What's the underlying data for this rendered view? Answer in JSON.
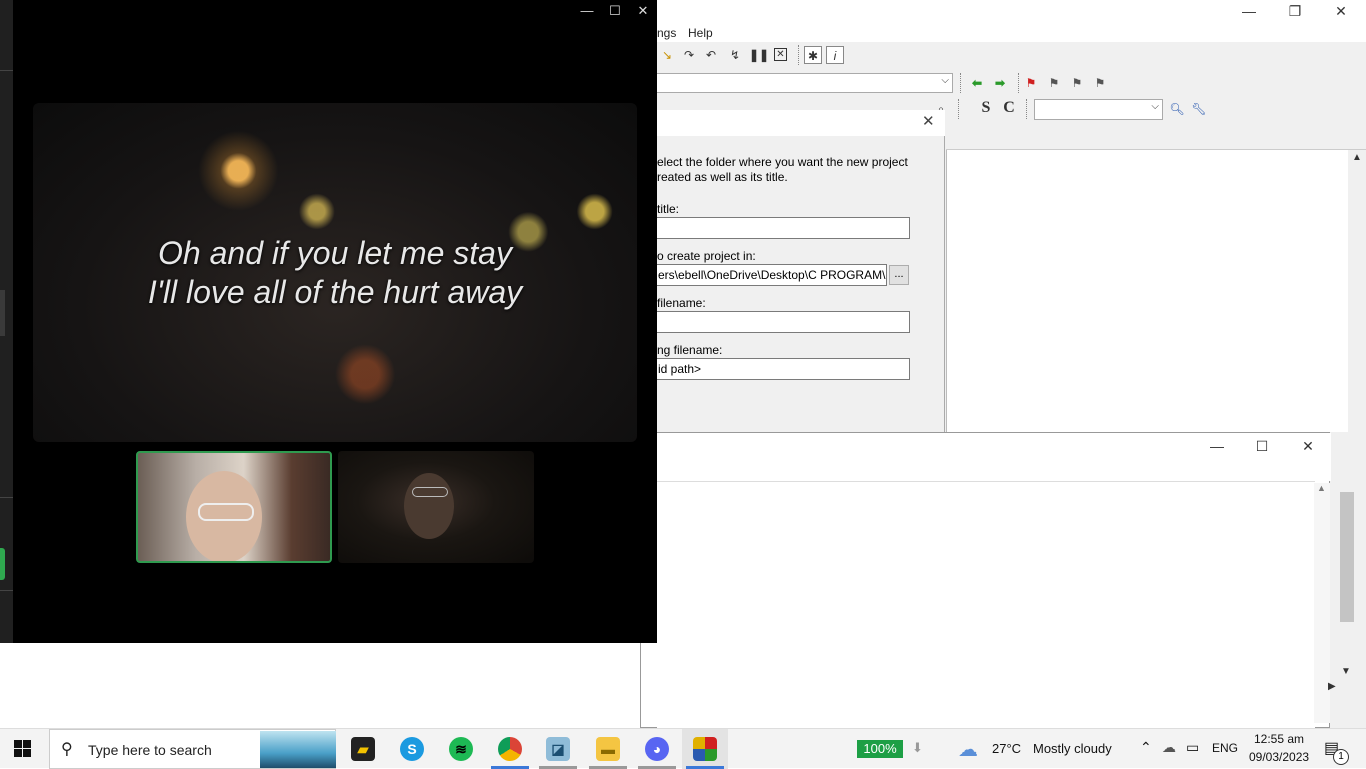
{
  "ide": {
    "menu": {
      "settings_partial": "ngs",
      "help": "Help"
    },
    "window_controls": {
      "minimize": "—",
      "restore": "❐",
      "close": "✕"
    }
  },
  "dialog": {
    "close_icon": "✕",
    "instructions_line1": "elect the folder where you want the new project",
    "instructions_line2": "reated as well as its title.",
    "title_label": "title:",
    "title_value": "",
    "folder_label": "o create project in:",
    "folder_value": "ers\\ebell\\OneDrive\\Desktop\\C PROGRAM\\",
    "browse_label": "...",
    "filename_label": "filename:",
    "filename_value": "",
    "existing_label": "ng filename:",
    "existing_value": "id path>"
  },
  "console": {
    "window_controls": {
      "minimize": "—",
      "maximize": "☐",
      "close": "✕"
    }
  },
  "call": {
    "window_controls": {
      "minimize": "—",
      "maximize": "☐",
      "close": "✕"
    },
    "lyric_line1": "Oh and if you let me stay",
    "lyric_line2": "I'll love all of the hurt away"
  },
  "taskbar": {
    "search_placeholder": "Type here to search",
    "battery": "100%",
    "weather_temp": "27°C",
    "weather_desc": "Mostly cloudy",
    "language": "ENG",
    "time": "12:55 am",
    "date": "09/03/2023",
    "notification_count": "1",
    "colors": {
      "accent": "#3b78d8",
      "battery_green": "#1d9f45"
    }
  }
}
